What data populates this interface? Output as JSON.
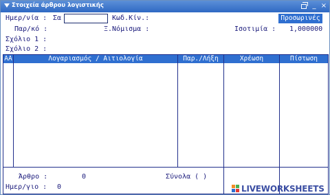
{
  "window": {
    "title": "Στοιχεία άρθρου λογιστικής"
  },
  "header": {
    "date_label": "Ημερ/νία :",
    "date_value": "Σα",
    "code_label": "Κωδ.Κίν.:",
    "status_badge": "Προσωρινές",
    "doc_label": "Παρ/κό    :",
    "currency_label": "Ξ.Νόμισμα :",
    "rate_label": "Ισοτιμία :",
    "rate_value": "1,000000",
    "comment1_label": "Σχόλιο 1 :",
    "comment2_label": "Σχόλιο 2 :"
  },
  "table": {
    "columns": [
      "AA",
      "Λογαριασμός / Αιτιολογία",
      "Παρ./Λήξη",
      "Χρέωση",
      "Πίστωση"
    ],
    "rows": []
  },
  "footer": {
    "article_label": "Άρθρο :",
    "article_value": "0",
    "totals_label": "Σύνολα (   )",
    "daybook_label": "Ημερ/γιο :",
    "daybook_value": "0"
  },
  "watermark": {
    "text": "LIVEWORKSHEETS",
    "colors": [
      "#f28c28",
      "#4caf50",
      "#2f6fd0",
      "#e53935"
    ]
  }
}
